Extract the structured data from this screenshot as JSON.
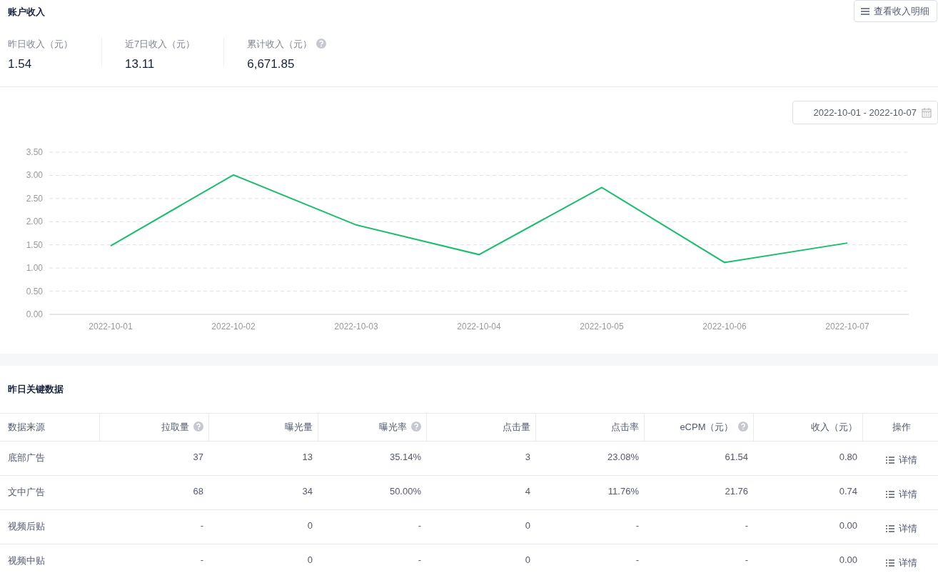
{
  "account": {
    "title": "账户收入",
    "detail_button": "查看收入明细"
  },
  "stats": [
    {
      "label": "昨日收入（元）",
      "value": "1.54",
      "help": false
    },
    {
      "label": "近7日收入（元）",
      "value": "13.11",
      "help": false
    },
    {
      "label": "累计收入（元）",
      "value": "6,671.85",
      "help": true
    }
  ],
  "date_range": "2022-10-01 - 2022-10-07",
  "chart_data": {
    "type": "line",
    "categories": [
      "2022-10-01",
      "2022-10-02",
      "2022-10-03",
      "2022-10-04",
      "2022-10-05",
      "2022-10-06",
      "2022-10-07"
    ],
    "grid": true,
    "series": [
      {
        "color": "#19be6b",
        "values": [
          1.48,
          3.01,
          1.93,
          1.29,
          2.74,
          1.12,
          1.54
        ]
      }
    ],
    "ylim": [
      0,
      3.5
    ],
    "yticks": [
      {
        "value": 0,
        "label": "0.00"
      },
      {
        "value": 0.5,
        "label": "0.50"
      },
      {
        "value": 1,
        "label": "1.00"
      },
      {
        "value": 1.5,
        "label": "1.50"
      },
      {
        "value": 2,
        "label": "2.00"
      },
      {
        "value": 2.5,
        "label": "2.50"
      },
      {
        "value": 3,
        "label": "3.00"
      },
      {
        "value": 3.5,
        "label": "3.50"
      }
    ]
  },
  "key_data": {
    "title": "昨日关键数据",
    "columns": [
      {
        "label": "数据来源",
        "help": false
      },
      {
        "label": "拉取量",
        "help": true
      },
      {
        "label": "曝光量",
        "help": false
      },
      {
        "label": "曝光率",
        "help": true
      },
      {
        "label": "点击量",
        "help": false
      },
      {
        "label": "点击率",
        "help": false
      },
      {
        "label": "eCPM（元）",
        "help": true
      },
      {
        "label": "收入（元）",
        "help": false
      },
      {
        "label": "操作",
        "help": false
      }
    ],
    "rows": [
      {
        "cells": [
          "底部广告",
          "37",
          "13",
          "35.14%",
          "3",
          "23.08%",
          "61.54",
          "0.80"
        ],
        "action": "详情"
      },
      {
        "cells": [
          "文中广告",
          "68",
          "34",
          "50.00%",
          "4",
          "11.76%",
          "21.76",
          "0.74"
        ],
        "action": "详情"
      },
      {
        "cells": [
          "视频后贴",
          "-",
          "0",
          "-",
          "0",
          "-",
          "-",
          "0.00"
        ],
        "action": "详情"
      },
      {
        "cells": [
          "视频中贴",
          "-",
          "0",
          "-",
          "0",
          "-",
          "-",
          "0.00"
        ],
        "action": "详情"
      }
    ]
  }
}
